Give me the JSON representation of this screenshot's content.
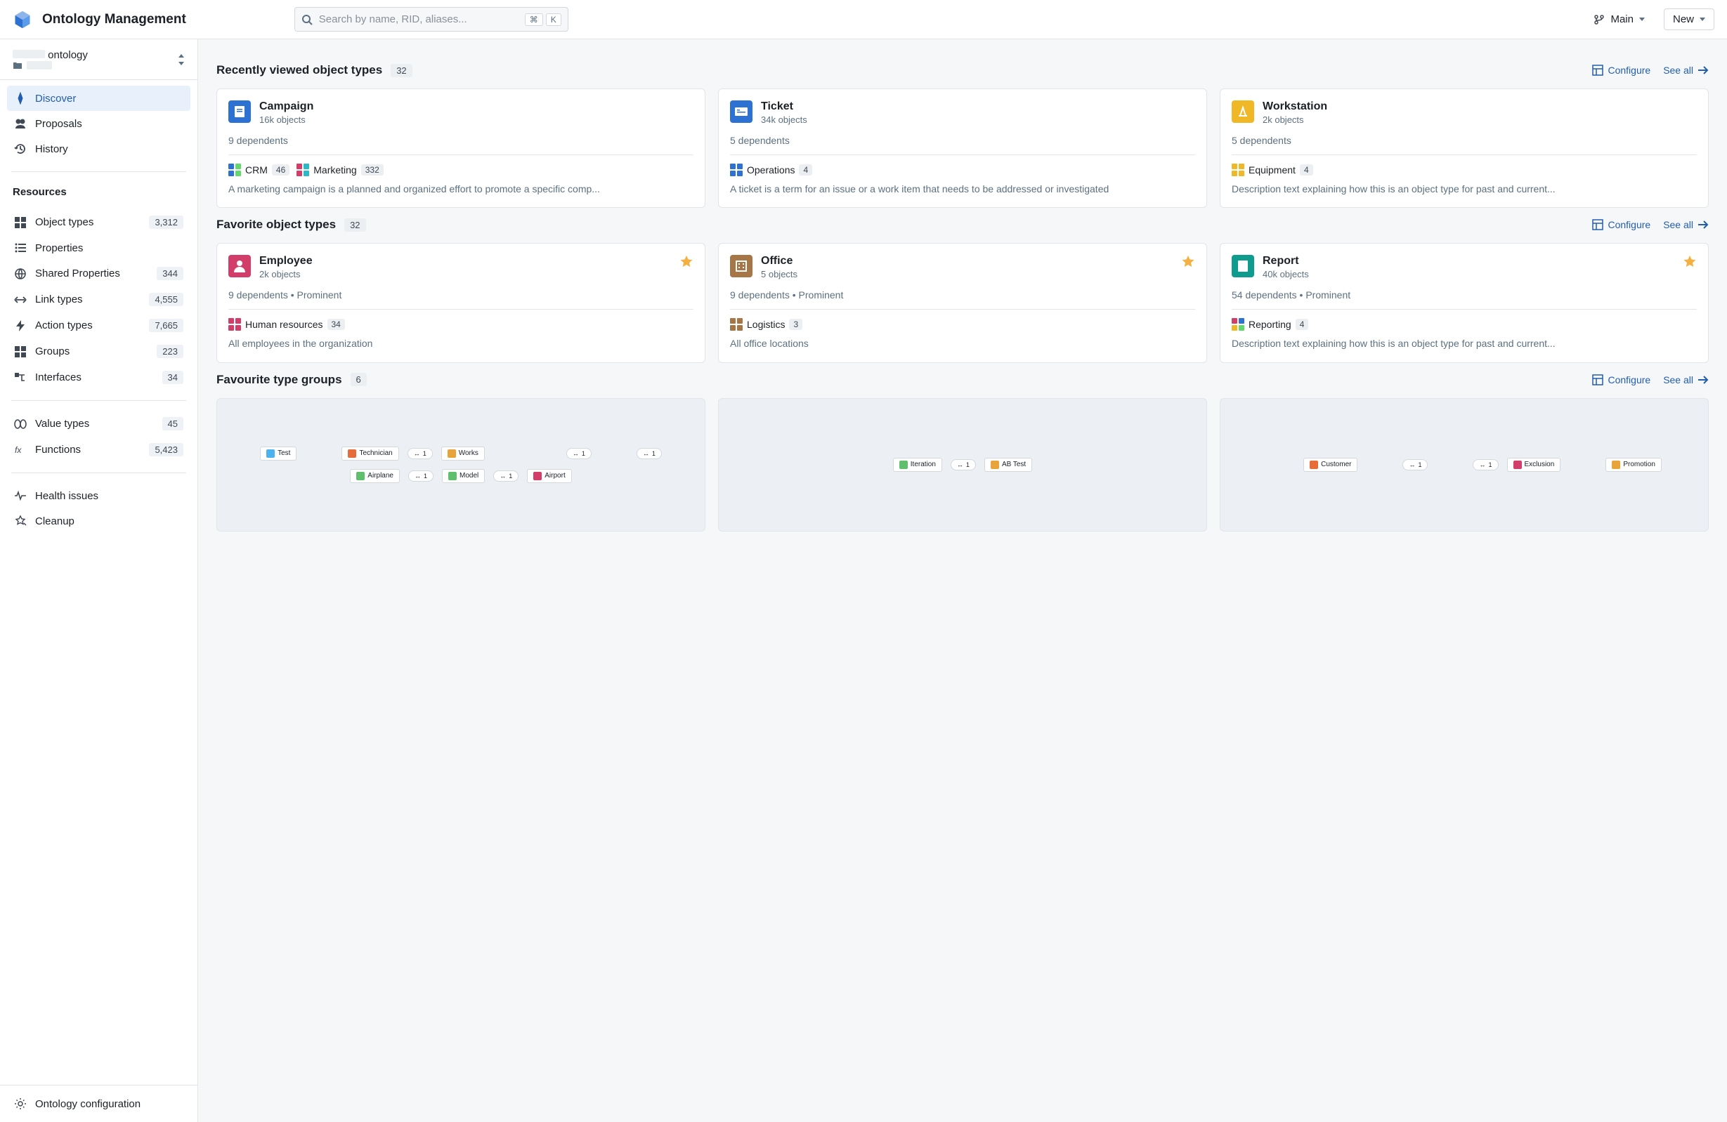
{
  "header": {
    "app_title": "Ontology Management",
    "search_placeholder": "Search by name, RID, aliases...",
    "kbd1": "⌘",
    "kbd2": "K",
    "branch_label": "Main",
    "new_label": "New"
  },
  "sidebar": {
    "ontology_name": "ontology",
    "nav": [
      {
        "label": "Discover",
        "active": true
      },
      {
        "label": "Proposals",
        "active": false
      },
      {
        "label": "History",
        "active": false
      }
    ],
    "resources_title": "Resources",
    "resources": [
      {
        "label": "Object types",
        "count": "3,312"
      },
      {
        "label": "Properties",
        "count": ""
      },
      {
        "label": "Shared Properties",
        "count": "344"
      },
      {
        "label": "Link types",
        "count": "4,555"
      },
      {
        "label": "Action types",
        "count": "7,665"
      },
      {
        "label": "Groups",
        "count": "223"
      },
      {
        "label": "Interfaces",
        "count": "34"
      }
    ],
    "extras": [
      {
        "label": "Value types",
        "count": "45"
      },
      {
        "label": "Functions",
        "count": "5,423"
      }
    ],
    "bottom": [
      {
        "label": "Health issues"
      },
      {
        "label": "Cleanup"
      }
    ],
    "config_label": "Ontology configuration"
  },
  "sections": {
    "recent": {
      "title": "Recently viewed object types",
      "count": "32",
      "configure": "Configure",
      "see_all": "See all",
      "cards": [
        {
          "title": "Campaign",
          "sub": "16k objects",
          "meta": "9 dependents",
          "color": "#2d72d2",
          "groups": [
            {
              "name": "CRM",
              "count": "46",
              "colors": [
                "#2d72d2",
                "#62d96b",
                "#2d72d2",
                "#62d96b"
              ]
            },
            {
              "name": "Marketing",
              "count": "332",
              "colors": [
                "#d33d6a",
                "#2bbac5",
                "#d33d6a",
                "#2bbac5"
              ]
            }
          ],
          "desc": "A marketing campaign is a planned and organized effort to promote a specific comp..."
        },
        {
          "title": "Ticket",
          "sub": "34k objects",
          "meta": "5 dependents",
          "color": "#2d72d2",
          "groups": [
            {
              "name": "Operations",
              "count": "4",
              "colors": [
                "#2d72d2",
                "#2d72d2",
                "#2d72d2",
                "#2d72d2"
              ]
            }
          ],
          "desc": "A ticket is a term for an issue or a work item that needs to be addressed or investigated"
        },
        {
          "title": "Workstation",
          "sub": "2k objects",
          "meta": "5 dependents",
          "color": "#f0b726",
          "groups": [
            {
              "name": "Equipment",
              "count": "4",
              "colors": [
                "#f0b726",
                "#f0b726",
                "#f0b726",
                "#f0b726"
              ]
            }
          ],
          "desc": "Description text explaining how this is an object type for past and current..."
        }
      ]
    },
    "favorite": {
      "title": "Favorite object types",
      "count": "32",
      "configure": "Configure",
      "see_all": "See all",
      "cards": [
        {
          "title": "Employee",
          "sub": "2k objects",
          "meta": "9 dependents  •  Prominent",
          "color": "#d33d6a",
          "groups": [
            {
              "name": "Human resources",
              "count": "34",
              "colors": [
                "#d33d6a",
                "#d33d6a",
                "#d33d6a",
                "#d33d6a"
              ]
            }
          ],
          "desc": "All employees in the organization"
        },
        {
          "title": "Office",
          "sub": "5 objects",
          "meta": "9 dependents  •  Prominent",
          "color": "#a67646",
          "groups": [
            {
              "name": "Logistics",
              "count": "3",
              "colors": [
                "#a67646",
                "#a67646",
                "#a67646",
                "#a67646"
              ]
            }
          ],
          "desc": "All office locations"
        },
        {
          "title": "Report",
          "sub": "40k objects",
          "meta": "54 dependents  •  Prominent",
          "color": "#0f9b8e",
          "groups": [
            {
              "name": "Reporting",
              "count": "4",
              "colors": [
                "#d33d6a",
                "#2d72d2",
                "#f0b726",
                "#62d96b"
              ]
            }
          ],
          "desc": "Description text explaining how this is an object type for past and current..."
        }
      ]
    },
    "groups": {
      "title": "Favourite type groups",
      "count": "6",
      "configure": "Configure",
      "see_all": "See all",
      "previews": [
        {
          "rows": [
            [
              {
                "label": "Test",
                "color": "#4cb3f0"
              },
              null,
              {
                "label": "Technician",
                "color": "#e86c3a"
              },
              {
                "link": "1"
              },
              {
                "label": "Works",
                "color": "#e8a33a"
              }
            ],
            [
              null,
              null,
              {
                "link": "1"
              },
              null,
              {
                "link": "1"
              }
            ],
            [
              {
                "label": "Airplane",
                "color": "#5fbf6d"
              },
              {
                "link": "1"
              },
              {
                "label": "Model",
                "color": "#5fbf6d"
              },
              {
                "link": "1"
              },
              {
                "label": "Airport",
                "color": "#d33d6a"
              }
            ]
          ]
        },
        {
          "rows": [
            [
              {
                "label": "Iteration",
                "color": "#5fbf6d"
              },
              {
                "link": "1"
              },
              {
                "label": "AB Test",
                "color": "#e8a33a"
              }
            ]
          ]
        },
        {
          "rows": [
            [
              null,
              {
                "label": "Customer",
                "color": "#e86c3a"
              },
              null
            ],
            [
              {
                "link": "1"
              },
              null,
              {
                "link": "1"
              }
            ],
            [
              {
                "label": "Exclusion",
                "color": "#d33d6a"
              },
              null,
              {
                "label": "Promotion",
                "color": "#e8a33a"
              }
            ]
          ]
        }
      ]
    }
  }
}
